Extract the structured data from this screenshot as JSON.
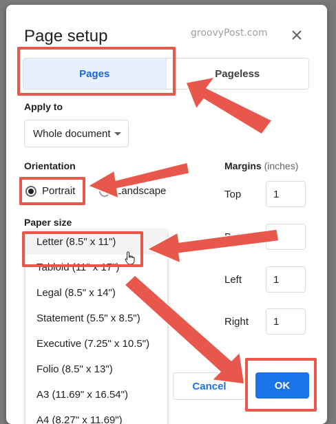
{
  "dialog": {
    "title": "Page setup",
    "watermark": "groovyPost.com",
    "close_icon": "close-icon"
  },
  "tabs": [
    {
      "label": "Pages",
      "active": true
    },
    {
      "label": "Pageless",
      "active": false
    }
  ],
  "apply_to": {
    "label": "Apply to",
    "value": "Whole document"
  },
  "orientation": {
    "label": "Orientation",
    "options": [
      {
        "label": "Portrait",
        "selected": true
      },
      {
        "label": "Landscape",
        "selected": false
      }
    ]
  },
  "margins": {
    "label": "Margins",
    "unit": "(inches)",
    "fields": [
      {
        "label": "Top",
        "value": "1"
      },
      {
        "label": "Bottom",
        "value": ""
      },
      {
        "label": "Left",
        "value": "1"
      },
      {
        "label": "Right",
        "value": "1"
      }
    ]
  },
  "paper_size": {
    "label": "Paper size",
    "options": [
      "Letter (8.5\" x 11\")",
      "Tabloid (11\" x 17\")",
      "Legal (8.5\" x 14\")",
      "Statement (5.5\" x 8.5\")",
      "Executive (7.25\" x 10.5\")",
      "Folio (8.5\" x 13\")",
      "A3 (11.69\" x 16.54\")",
      "A4 (8.27\" x 11.69\")"
    ]
  },
  "buttons": {
    "cancel": "Cancel",
    "ok": "OK"
  },
  "annotation_color": "#e8574b"
}
